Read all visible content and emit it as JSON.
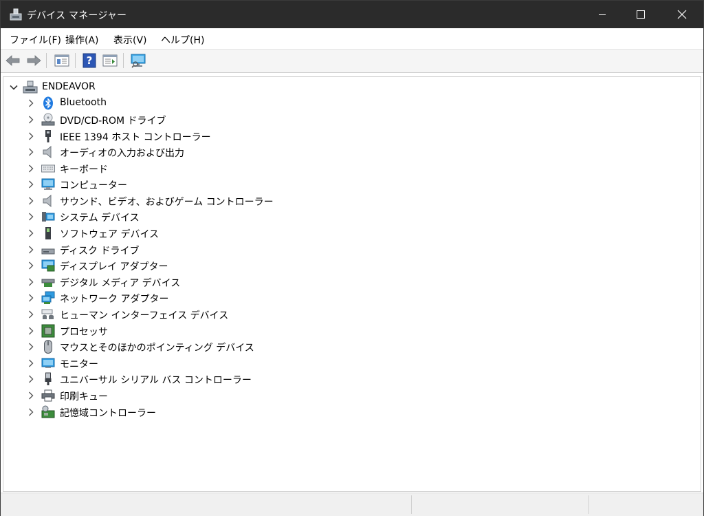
{
  "window": {
    "title": "デバイス マネージャー"
  },
  "menu": [
    {
      "label": "ファイル(F)"
    },
    {
      "label": "操作(A)"
    },
    {
      "label": "表示(V)"
    },
    {
      "label": "ヘルプ(H)"
    }
  ],
  "tree": {
    "root": "ENDEAVOR",
    "items": [
      {
        "label": "Bluetooth",
        "icon": "bluetooth-icon"
      },
      {
        "label": "DVD/CD-ROM ドライブ",
        "icon": "dvd-drive-icon"
      },
      {
        "label": "IEEE 1394 ホスト コントローラー",
        "icon": "ieee1394-icon"
      },
      {
        "label": "オーディオの入力および出力",
        "icon": "speaker-icon"
      },
      {
        "label": "キーボード",
        "icon": "keyboard-icon"
      },
      {
        "label": "コンピューター",
        "icon": "computer-icon"
      },
      {
        "label": "サウンド、ビデオ、およびゲーム コントローラー",
        "icon": "sound-icon"
      },
      {
        "label": "システム デバイス",
        "icon": "system-device-icon"
      },
      {
        "label": "ソフトウェア デバイス",
        "icon": "software-device-icon"
      },
      {
        "label": "ディスク ドライブ",
        "icon": "disk-drive-icon"
      },
      {
        "label": "ディスプレイ アダプター",
        "icon": "display-adapter-icon"
      },
      {
        "label": "デジタル メディア デバイス",
        "icon": "digital-media-icon"
      },
      {
        "label": "ネットワーク アダプター",
        "icon": "network-adapter-icon"
      },
      {
        "label": "ヒューマン インターフェイス デバイス",
        "icon": "hid-icon"
      },
      {
        "label": "プロセッサ",
        "icon": "processor-icon"
      },
      {
        "label": "マウスとそのほかのポインティング デバイス",
        "icon": "mouse-icon"
      },
      {
        "label": "モニター",
        "icon": "monitor-icon"
      },
      {
        "label": "ユニバーサル シリアル バス コントローラー",
        "icon": "usb-icon"
      },
      {
        "label": "印刷キュー",
        "icon": "printer-icon"
      },
      {
        "label": "記憶域コントローラー",
        "icon": "storage-controller-icon"
      }
    ]
  }
}
